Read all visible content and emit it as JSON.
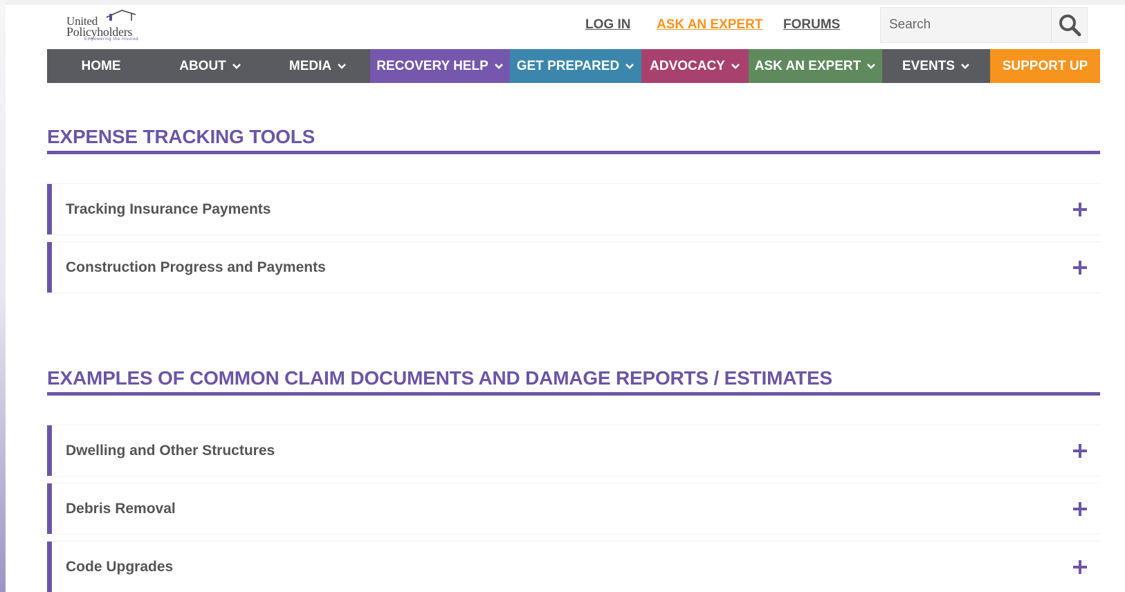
{
  "header": {
    "logo": {
      "line1": "United",
      "line2": "Policyholders",
      "tagline": "Empowering the Insured"
    },
    "links": [
      {
        "label": "LOG IN"
      },
      {
        "label": "ASK AN EXPERT"
      },
      {
        "label": "FORUMS"
      }
    ],
    "search": {
      "placeholder": "Search"
    }
  },
  "nav": {
    "items": [
      {
        "label": "HOME",
        "color": "#5a5b60"
      },
      {
        "label": "ABOUT",
        "color": "#5a5b60"
      },
      {
        "label": "MEDIA",
        "color": "#5a5b60"
      },
      {
        "label": "RECOVERY HELP",
        "color": "#7558ad"
      },
      {
        "label": "GET PREPARED",
        "color": "#3b87ab"
      },
      {
        "label": "ADVOCACY",
        "color": "#a8416d"
      },
      {
        "label": "ASK AN EXPERT",
        "color": "#5f8a5d"
      },
      {
        "label": "EVENTS",
        "color": "#5a5b60"
      },
      {
        "label": "SUPPORT UP",
        "color": "#f7941d"
      }
    ]
  },
  "sections": [
    {
      "title": "EXPENSE TRACKING TOOLS",
      "items": [
        {
          "label": "Tracking Insurance Payments"
        },
        {
          "label": "Construction Progress and Payments"
        }
      ]
    },
    {
      "title": "EXAMPLES OF COMMON CLAIM DOCUMENTS AND DAMAGE REPORTS / ESTIMATES",
      "items": [
        {
          "label": "Dwelling and Other Structures"
        },
        {
          "label": "Debris Removal"
        },
        {
          "label": "Code Upgrades"
        }
      ]
    }
  ],
  "colors": {
    "accent": "#6c55a6",
    "link_highlight": "#f7941d",
    "text": "#555555"
  },
  "icons": [
    "search-icon",
    "chevron-down-icon",
    "plus-icon",
    "house-icon"
  ]
}
